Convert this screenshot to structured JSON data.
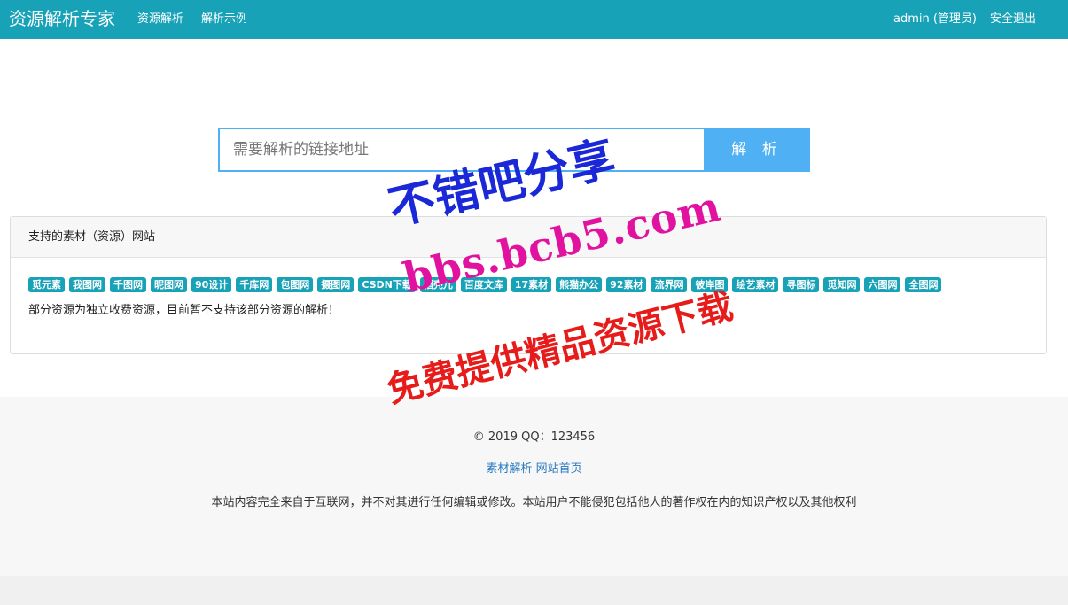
{
  "header": {
    "brand": "资源解析专家",
    "nav": [
      "资源解析",
      "解析示例"
    ],
    "user": "admin (管理员)",
    "logout": "安全退出"
  },
  "search": {
    "placeholder": "需要解析的链接地址",
    "button": "解 析"
  },
  "panel": {
    "title": "支持的素材（资源）网站",
    "tags": [
      "觅元素",
      "我图网",
      "千图网",
      "昵图网",
      "90设计",
      "千库网",
      "包图网",
      "摄图网",
      "CSDN下载",
      "稻壳儿",
      "百度文库",
      "17素材",
      "熊猫办公",
      "92素材",
      "流界网",
      "彼岸图",
      "绘艺素材",
      "寻图标",
      "觅知网",
      "六图网",
      "全图网"
    ],
    "note": "部分资源为独立收费资源，目前暂不支持该部分资源的解析！"
  },
  "footer": {
    "copyright": "© 2019 QQ：123456",
    "links": [
      "素材解析",
      "网站首页"
    ],
    "disclaimer": "本站内容完全来自于互联网，并不对其进行任何编辑或修改。本站用户不能侵犯包括他人的著作权在内的知识产权以及其他权利"
  },
  "watermark": {
    "line1": "不错吧分享",
    "line2": "bbs.bcb5.com",
    "line3": "免费提供精品资源下载"
  },
  "colors": {
    "header_bg": "#17a2b8",
    "button_bg": "#4fb0f4",
    "tag_bg": "#17a2b8",
    "link": "#2a7ac0"
  }
}
